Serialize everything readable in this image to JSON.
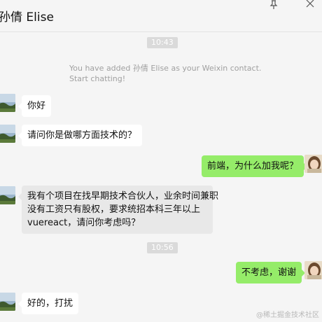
{
  "header": {
    "title": "孙倩 Elise",
    "pin_icon": "pin-icon",
    "close_icon": "close-icon"
  },
  "messages": {
    "time1": "10:43",
    "system_line1": "You have added 孙倩 Elise as your Weixin contact.",
    "system_line2": "Start chatting!",
    "m1": "你好",
    "m2": "请问你是做哪方面技术的？",
    "m3": "前端，为什么加我呢？",
    "m4_line1": "我有个项目在找早期技术合伙人，业余时间兼职",
    "m4_line2": "没有工资只有股权，要求统招本科三年以上",
    "m4_line3": "vuereact，请问你考虑吗？",
    "time2": "10:56",
    "m5": "不考虑，谢谢",
    "m6": "好的，打扰"
  },
  "watermark": "@稀土掘金技术社区",
  "colors": {
    "background": "#f5f5f5",
    "outgoing_bubble": "#95ec69",
    "incoming_bubble": "#ffffff",
    "time_badge": "#dadada"
  }
}
